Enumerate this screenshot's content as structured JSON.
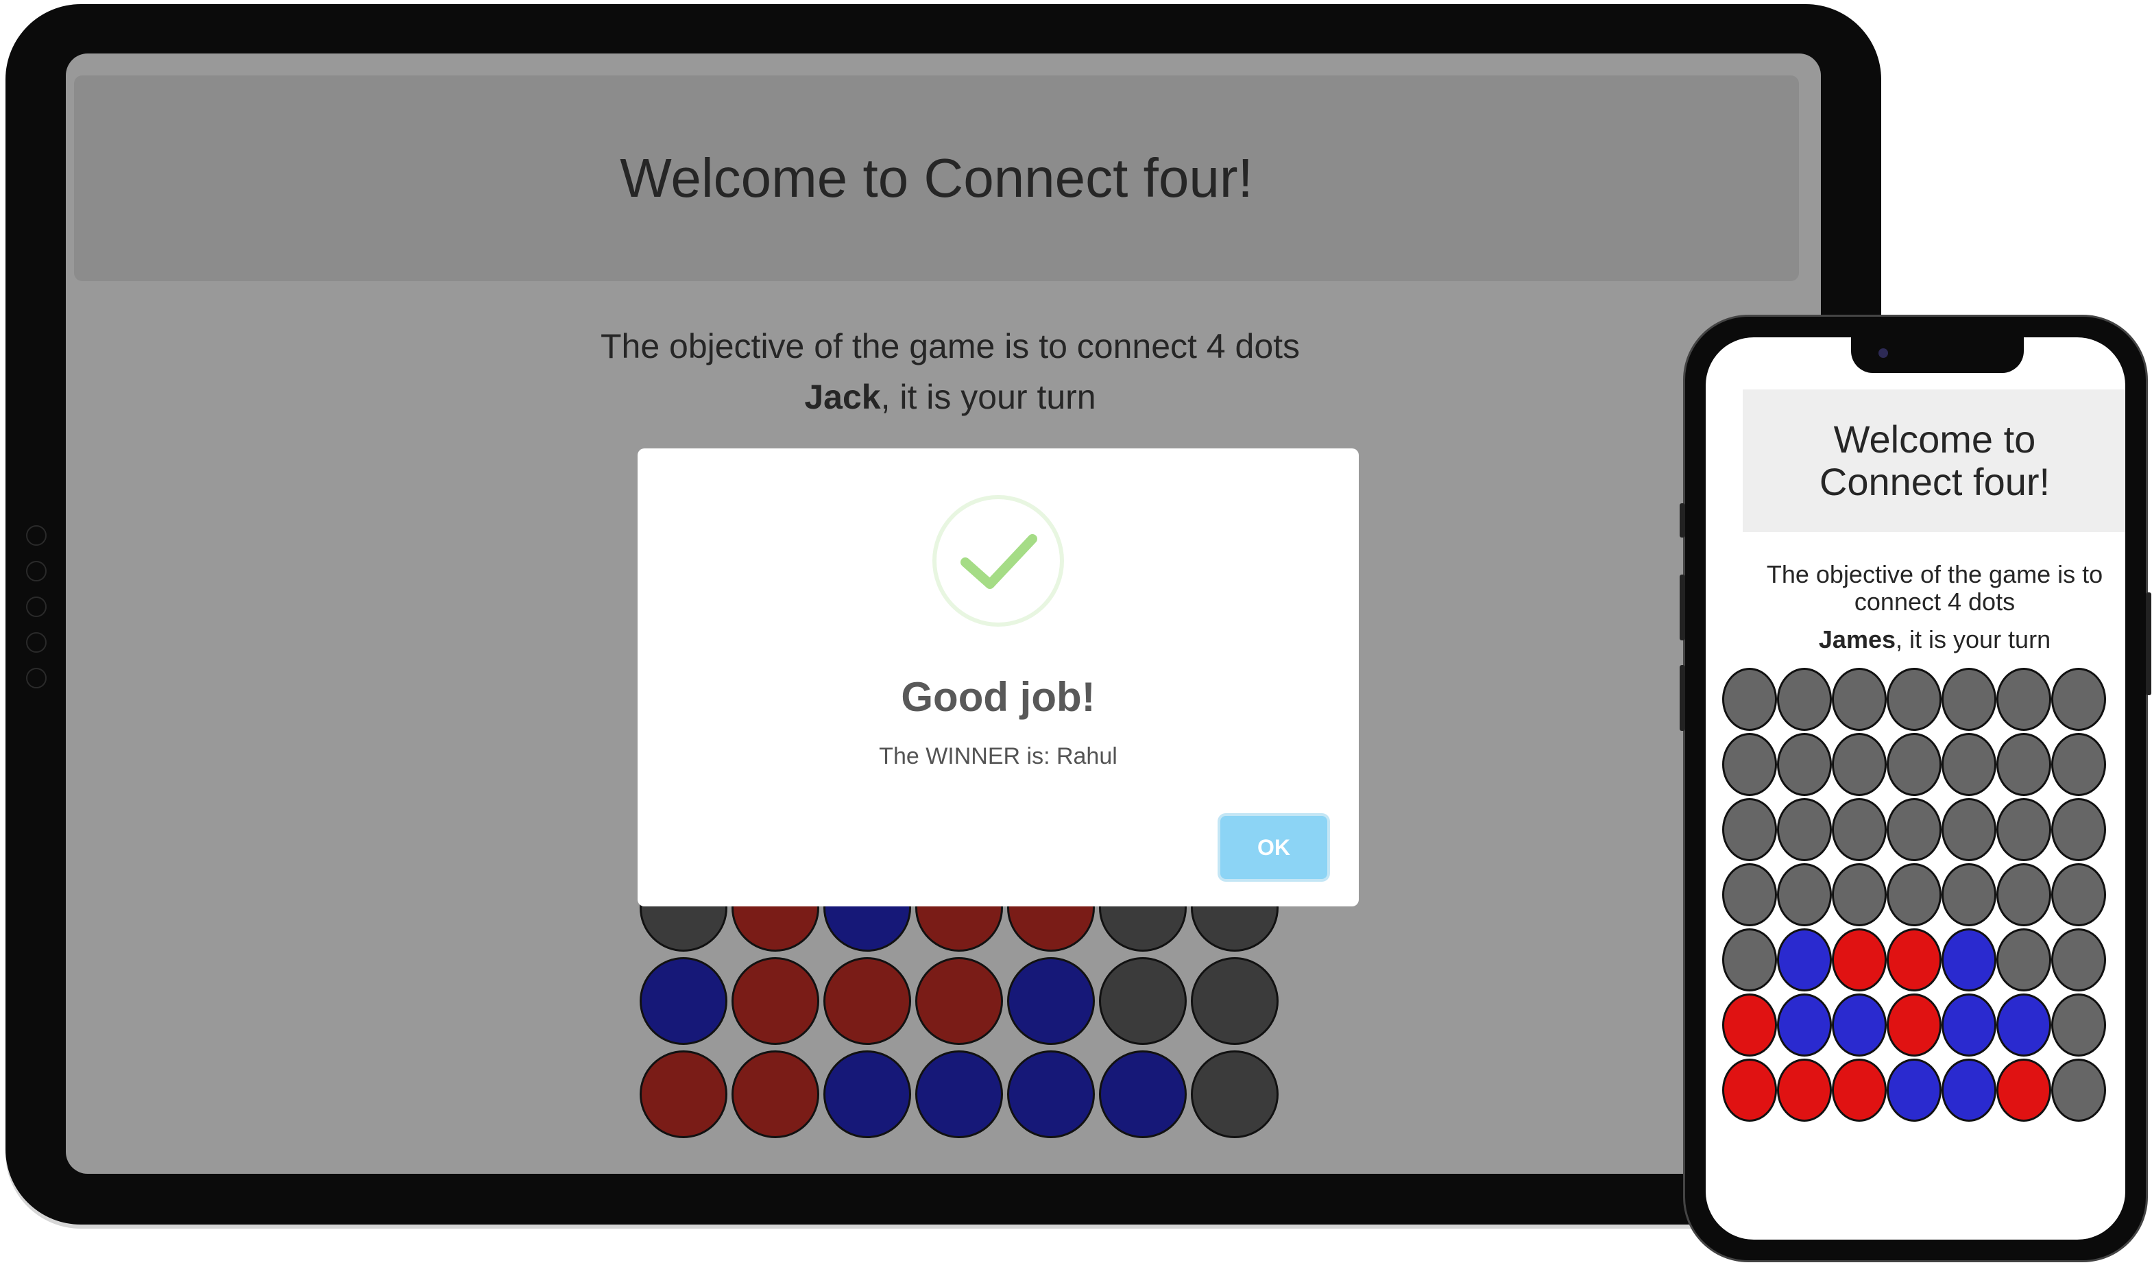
{
  "tablet": {
    "header": {
      "title": "Welcome to Connect four!"
    },
    "objective": "The objective of the game is to connect 4 dots",
    "turn": {
      "player": "Jack",
      "suffix": ", it is your turn"
    },
    "board": {
      "columns": 7,
      "visible_rows": [
        [
          "dark",
          "red",
          "blue",
          "red",
          "red",
          "dark",
          "dark"
        ],
        [
          "blue",
          "red",
          "red",
          "red",
          "blue",
          "dark",
          "dark"
        ],
        [
          "red",
          "red",
          "blue",
          "blue",
          "blue",
          "blue",
          "dark"
        ]
      ]
    },
    "colors": {
      "red": "#7a1c17",
      "blue": "#161878",
      "dark": "#3b3b3b"
    }
  },
  "modal": {
    "icon": "success-check-icon",
    "title": "Good job!",
    "text": "The WINNER is: Rahul",
    "ok_label": "OK"
  },
  "phone": {
    "header": {
      "title": "Welcome to Connect four!"
    },
    "objective": "The objective of the game is to connect 4 dots",
    "turn": {
      "player": "James",
      "suffix": ", it is your turn"
    },
    "board": {
      "columns": 7,
      "rows": [
        [
          "empty",
          "empty",
          "empty",
          "empty",
          "empty",
          "empty",
          "empty"
        ],
        [
          "empty",
          "empty",
          "empty",
          "empty",
          "empty",
          "empty",
          "empty"
        ],
        [
          "empty",
          "empty",
          "empty",
          "empty",
          "empty",
          "empty",
          "empty"
        ],
        [
          "empty",
          "empty",
          "empty",
          "empty",
          "empty",
          "empty",
          "empty"
        ],
        [
          "empty",
          "blue",
          "red",
          "red",
          "blue",
          "empty",
          "empty"
        ],
        [
          "red",
          "blue",
          "blue",
          "red",
          "blue",
          "blue",
          "empty"
        ],
        [
          "red",
          "red",
          "red",
          "blue",
          "blue",
          "red",
          "empty"
        ]
      ]
    },
    "colors": {
      "red": "#e01212",
      "blue": "#2a2acf",
      "empty": "#666666"
    }
  }
}
